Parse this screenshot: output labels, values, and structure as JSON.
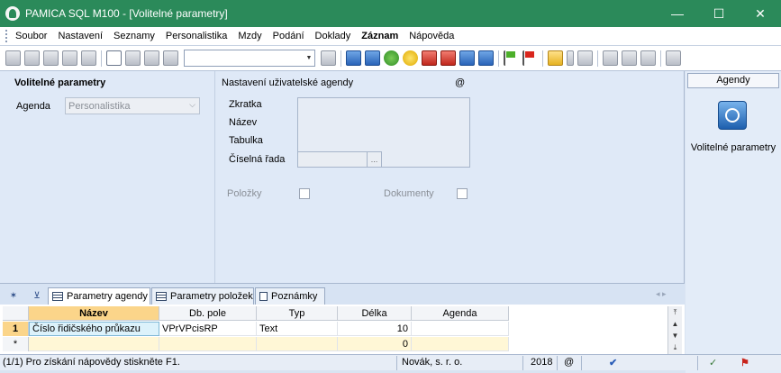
{
  "window": {
    "title": "PAMICA SQL M100 - [Volitelné parametry]",
    "min": "—",
    "max": "☐",
    "close": "✕"
  },
  "menu": [
    "Soubor",
    "Nastavení",
    "Seznamy",
    "Personalistika",
    "Mzdy",
    "Podání",
    "Doklady",
    "Záznam",
    "Nápověda"
  ],
  "left": {
    "heading": "Volitelné parametry",
    "agenda_label": "Agenda",
    "agenda_value": "Personalistika"
  },
  "right": {
    "heading": "Nastavení uživatelské agendy",
    "at": "@",
    "zkratka": "Zkratka",
    "nazev": "Název",
    "tabulka": "Tabulka",
    "cislena_rada": "Číselná řada",
    "polozky": "Položky",
    "dokumenty": "Dokumenty"
  },
  "sidebar": {
    "header": "Agendy",
    "item": "Volitelné parametry"
  },
  "tabs": {
    "star": "✶",
    "filter": "⊻",
    "t1": "Parametry agendy",
    "t2": "Parametry položek",
    "t3": "Poznámky",
    "nav": "◂ ▸"
  },
  "grid": {
    "columns": [
      "Název",
      "Db. pole",
      "Typ",
      "Délka",
      "Agenda"
    ],
    "rows": [
      {
        "num": "1",
        "nazev": "Číslo řidičského průkazu",
        "db": "VPrVPcisRP",
        "typ": "Text",
        "delka": "10",
        "agenda": ""
      }
    ],
    "new_row": {
      "mark": "*",
      "delka": "0"
    }
  },
  "status": {
    "help": "(1/1) Pro získání nápovědy stiskněte F1.",
    "company": "Novák, s. r. o.",
    "year": "2018",
    "at": "@"
  }
}
